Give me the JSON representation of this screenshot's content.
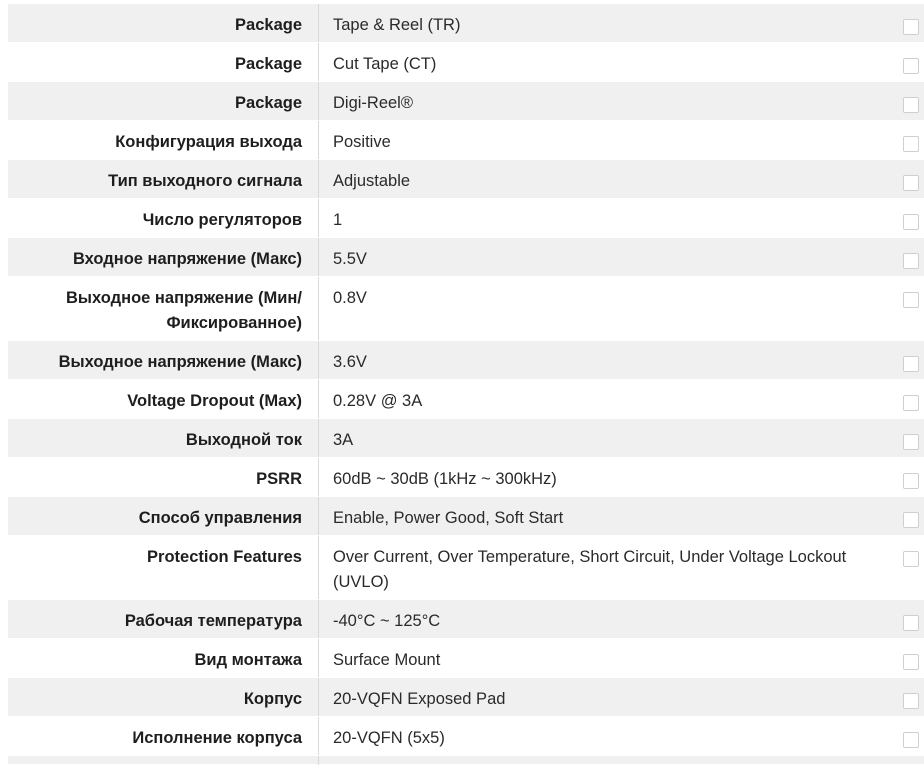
{
  "table": {
    "rows": [
      {
        "label": "Package",
        "value": "Tape & Reel (TR)"
      },
      {
        "label": "Package",
        "value": "Cut Tape (CT)"
      },
      {
        "label": "Package",
        "value": "Digi-Reel®"
      },
      {
        "label": "Конфигурация выхода",
        "value": "Positive"
      },
      {
        "label": "Тип выходного сигнала",
        "value": "Adjustable"
      },
      {
        "label": "Число регуляторов",
        "value": "1"
      },
      {
        "label": "Входное напряжение (Макс)",
        "value": "5.5V"
      },
      {
        "label": "Выходное напряжение (Мин/ Фиксированное)",
        "value": "0.8V"
      },
      {
        "label": "Выходное напряжение (Макс)",
        "value": "3.6V"
      },
      {
        "label": "Voltage Dropout (Max)",
        "value": "0.28V @ 3A"
      },
      {
        "label": "Выходной ток",
        "value": "3A"
      },
      {
        "label": "PSRR",
        "value": "60dB ~ 30dB (1kHz ~ 300kHz)"
      },
      {
        "label": "Способ управления",
        "value": "Enable, Power Good, Soft Start"
      },
      {
        "label": "Protection Features",
        "value": "Over Current, Over Temperature, Short Circuit, Under Voltage Lockout (UVLO)"
      },
      {
        "label": "Рабочая температура",
        "value": "-40°C ~ 125°C"
      },
      {
        "label": "Вид монтажа",
        "value": "Surface Mount"
      },
      {
        "label": "Корпус",
        "value": "20-VQFN Exposed Pad"
      },
      {
        "label": "Исполнение корпуса",
        "value": "20-VQFN (5x5)"
      }
    ]
  }
}
